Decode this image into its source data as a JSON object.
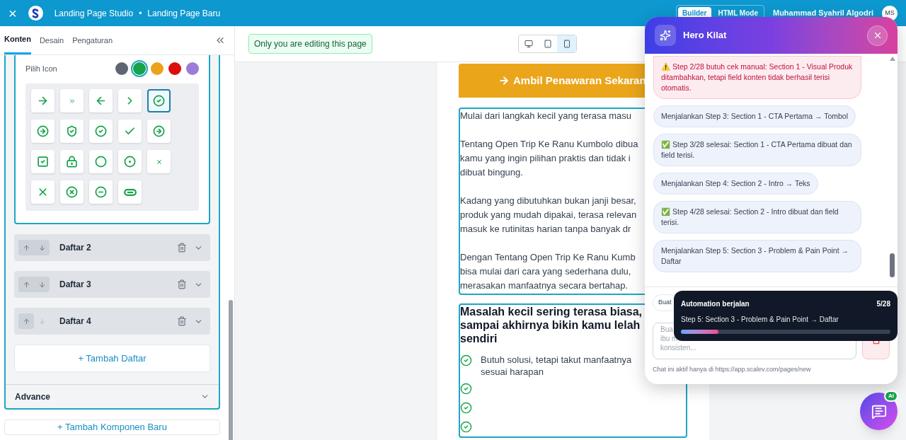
{
  "topbar": {
    "close": "×",
    "app": "Landing Page Studio",
    "separator": "•",
    "page": "Landing Page Baru",
    "modes": [
      {
        "label": "Builder",
        "selected": true
      },
      {
        "label": "HTML Mode",
        "selected": false
      }
    ],
    "user": "Muhammad Syahril Algodri",
    "avatar": "MS"
  },
  "sidebar": {
    "tabs": [
      {
        "label": "Konten",
        "selected": true
      },
      {
        "label": "Desain",
        "selected": false
      },
      {
        "label": "Pengaturan",
        "selected": false
      }
    ],
    "icon_picker": {
      "label": "Pilih Icon",
      "colors": [
        {
          "color": "#5f6672",
          "selected": false
        },
        {
          "color": "#16a34a",
          "selected": true
        },
        {
          "color": "#eaa31a",
          "selected": false
        },
        {
          "color": "#dc0d0d",
          "selected": false
        },
        {
          "color": "#9d7bd8",
          "selected": false
        }
      ],
      "icons": [
        {
          "kind": "arrow-right",
          "selected": false
        },
        {
          "kind": "chevrons-right",
          "selected": false
        },
        {
          "kind": "arrow-left",
          "selected": false
        },
        {
          "kind": "chevron-right",
          "selected": false
        },
        {
          "kind": "circle-check",
          "selected": true
        },
        {
          "kind": "circle-arrow",
          "selected": false
        },
        {
          "kind": "shield-check",
          "selected": false
        },
        {
          "kind": "circle-check",
          "selected": false
        },
        {
          "kind": "check",
          "selected": false
        },
        {
          "kind": "circle-arrow",
          "selected": false
        },
        {
          "kind": "square-check",
          "selected": false
        },
        {
          "kind": "lock",
          "selected": false
        },
        {
          "kind": "circle",
          "selected": false
        },
        {
          "kind": "circle-dot",
          "selected": false
        },
        {
          "kind": "x-small",
          "selected": false
        },
        {
          "kind": "x",
          "selected": false
        },
        {
          "kind": "circle-x",
          "selected": false
        },
        {
          "kind": "circle-minus",
          "selected": false
        },
        {
          "kind": "pill",
          "selected": false
        }
      ]
    },
    "items": [
      {
        "label": "Daftar 2",
        "down_enabled": true
      },
      {
        "label": "Daftar 3",
        "down_enabled": true
      },
      {
        "label": "Daftar 4",
        "down_enabled": false
      }
    ],
    "add_item": "+ Tambah Daftar",
    "advance": "Advance",
    "add_component": "+ Tambah Komponen Baru"
  },
  "canvas": {
    "notice": "Only you are editing this page",
    "devices": [
      {
        "kind": "desktop",
        "selected": false
      },
      {
        "kind": "tablet",
        "selected": false
      },
      {
        "kind": "mobile",
        "selected": true
      }
    ],
    "cta": "Ambil Penawaran Sekaran",
    "paragraphs": [
      [
        "Mulai dari langkah kecil yang terasa masu"
      ],
      [
        "Tentang Open Trip Ke Ranu Kumbolo dibua",
        "kamu yang ingin pilihan praktis dan tidak i",
        "dibuat bingung."
      ],
      [
        "Kadang yang dibutuhkan bukan janji besar,",
        "produk yang mudah dipakai, terasa relevan",
        "masuk ke rutinitas harian tanpa banyak dr"
      ],
      [
        "Dengan Tentang Open Trip Ke Ranu Kumb",
        "bisa mulai dari cara yang sederhana dulu,",
        "merasakan manfaatnya secara bertahap."
      ]
    ],
    "heading": [
      "Masalah kecil sering terasa biasa,",
      "sampai akhirnya bikin kamu lelah",
      "sendiri"
    ],
    "list": [
      {
        "kind": "text",
        "lines": [
          "Butuh solusi, tetapi takut manfaatnya",
          "sesuai harapan"
        ]
      },
      {
        "kind": "empty"
      },
      {
        "kind": "empty"
      },
      {
        "kind": "empty"
      }
    ]
  },
  "chat": {
    "title": "Hero Kilat",
    "messages": [
      {
        "kind": "warning",
        "icon": "⚠️",
        "text": "Step 2/28 butuh cek manual: Section 1 - Visual Produk ditambahkan, tetapi field konten tidak berhasil terisi otomatis."
      },
      {
        "kind": "info",
        "text": "Menjalankan Step 3: Section 1 - CTA Pertama → Tombol"
      },
      {
        "kind": "success",
        "icon": "✅",
        "text": "Step 3/28 selesai: Section 1 - CTA Pertama dibuat dan field terisi."
      },
      {
        "kind": "info",
        "text": "Menjalankan Step 4: Section 2 - Intro → Teks"
      },
      {
        "kind": "success",
        "icon": "✅",
        "text": "Step 4/28 selesai: Section 2 - Intro dibuat dan field terisi."
      },
      {
        "kind": "info",
        "text": "Menjalankan Step 5: Section 3 - Problem & Pain Point → Daftar"
      }
    ],
    "chip": "Buat",
    "input_lines": [
      "Bua",
      "ibu m",
      "konsisten..."
    ],
    "footer": "Chat ini aktif hanya di https://app.scalev.com/pages/new"
  },
  "toast": {
    "title": "Automation berjalan",
    "count": "5/28",
    "step": "Step 5: Section 3 - Problem & Pain Point → Daftar",
    "level": 0.18
  },
  "fab": {
    "badge": "AI"
  }
}
